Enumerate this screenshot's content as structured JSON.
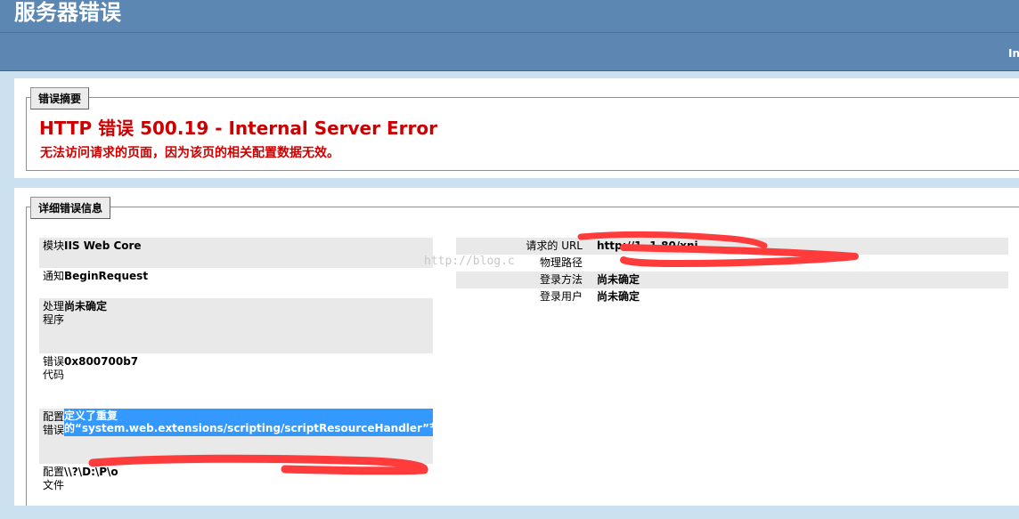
{
  "header": {
    "title": "服务器错误",
    "server_text": "In"
  },
  "summary": {
    "legend": "错误摘要",
    "title": "HTTP 错误 500.19 - Internal Server Error",
    "subtitle": "无法访问请求的页面，因为该页的相关配置数据无效。"
  },
  "details": {
    "legend": "详细错误信息",
    "left_rows": [
      {
        "label": "模块",
        "value": "IIS Web Core"
      },
      {
        "label": "通知",
        "value": "BeginRequest"
      },
      {
        "label": "处理程序",
        "value": "尚未确定"
      },
      {
        "label": "错误代码",
        "value": "0x800700b7"
      },
      {
        "label": "配置错误",
        "value_line1": "定义了重复",
        "value_line2": "的“system.web.extensions/scripting/scriptResourceHandler”节"
      },
      {
        "label": "配置文件",
        "value": "\\\\?\\D:\\P\\o"
      }
    ],
    "right_rows": [
      {
        "label": "请求的 URL",
        "value": "http://1 .1.80/xnj"
      },
      {
        "label": "物理路径",
        "value": ""
      },
      {
        "label": "登录方法",
        "value": "尚未确定"
      },
      {
        "label": "登录用户",
        "value": "尚未确定"
      }
    ]
  },
  "watermark": "http://blog.c",
  "colors": {
    "header": "#5c87b2",
    "error_red": "#cc0000",
    "selection": "#3399ff",
    "redaction": "#ff3b3b"
  }
}
